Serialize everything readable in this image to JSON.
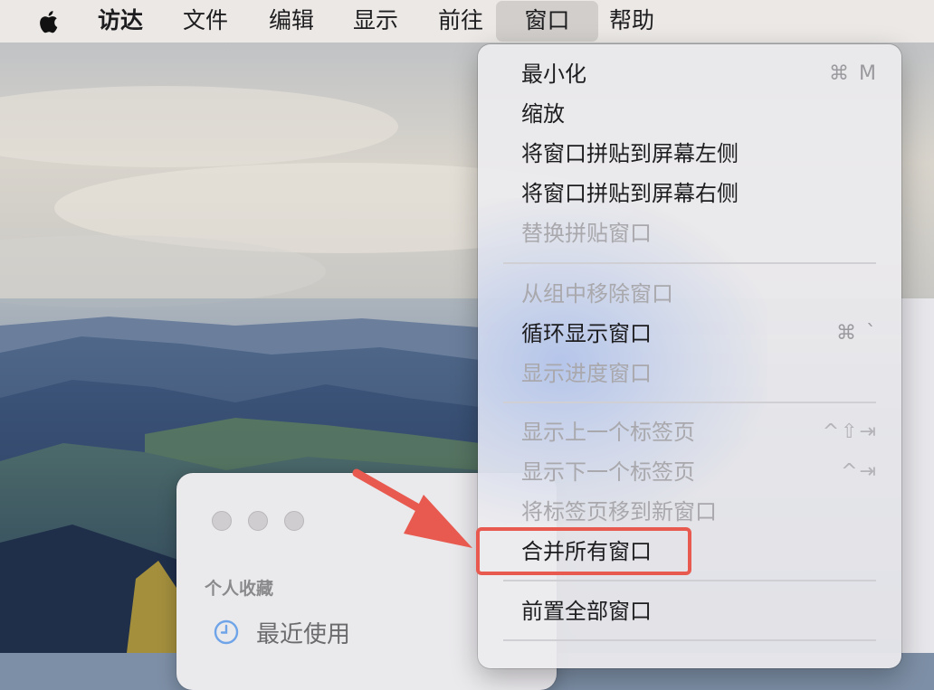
{
  "menubar": {
    "apple_icon": "apple-logo-icon",
    "items": [
      {
        "label": "访达",
        "bold": true
      },
      {
        "label": "文件"
      },
      {
        "label": "编辑"
      },
      {
        "label": "显示"
      },
      {
        "label": "前往"
      },
      {
        "label": "窗口",
        "active": true
      },
      {
        "label": "帮助"
      }
    ]
  },
  "window_menu": {
    "items": [
      {
        "label": "最小化",
        "shortcut": "⌘ M",
        "enabled": true
      },
      {
        "label": "缩放",
        "enabled": true
      },
      {
        "label": "将窗口拼贴到屏幕左侧",
        "enabled": true
      },
      {
        "label": "将窗口拼贴到屏幕右侧",
        "enabled": true
      },
      {
        "label": "替换拼贴窗口",
        "enabled": false
      },
      {
        "label": "从组中移除窗口",
        "enabled": false
      },
      {
        "label": "循环显示窗口",
        "shortcut": "⌘ `",
        "enabled": true
      },
      {
        "label": "显示进度窗口",
        "enabled": false
      },
      {
        "label": "显示上一个标签页",
        "shortcut": "^⇧⇥",
        "enabled": false
      },
      {
        "label": "显示下一个标签页",
        "shortcut": "^⇥",
        "enabled": false
      },
      {
        "label": "将标签页移到新窗口",
        "enabled": false
      },
      {
        "label": "合并所有窗口",
        "enabled": true,
        "highlighted": true
      },
      {
        "label": "前置全部窗口",
        "enabled": true
      }
    ]
  },
  "finder_window": {
    "sidebar_heading": "个人收藏",
    "sidebar_item_recent": "最近使用",
    "recent_icon": "clock-icon"
  },
  "annotation": {
    "color": "#e85a4f"
  }
}
